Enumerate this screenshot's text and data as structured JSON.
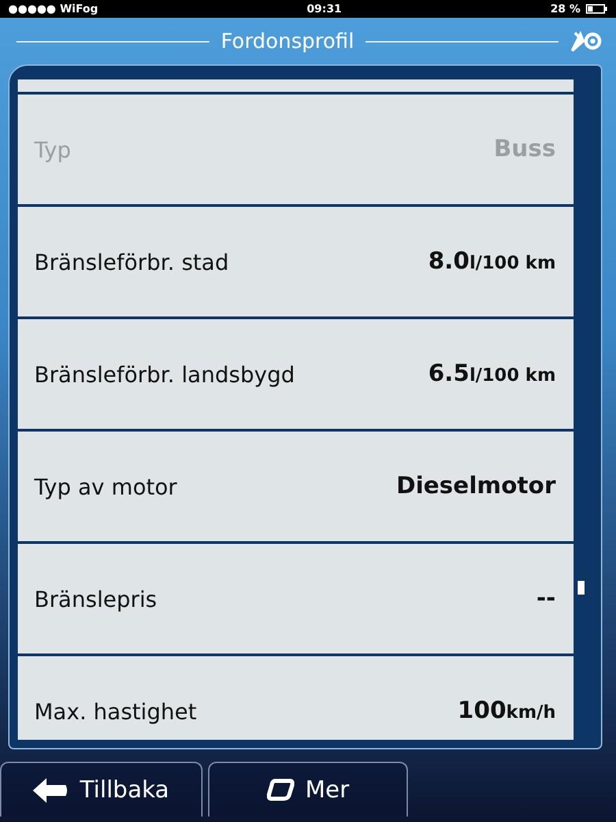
{
  "status_bar": {
    "carrier": "●●●●● WiFog",
    "time": "09:31",
    "battery": "28 %"
  },
  "header": {
    "title": "Fordonsprofil"
  },
  "rows": [
    {
      "label": "Typ",
      "value": "Buss",
      "disabled": true
    },
    {
      "label": "Bränsleförbr. stad",
      "value": "8.0",
      "unit": "l/100 km",
      "disabled": false
    },
    {
      "label": "Bränsleförbr. landsbygd",
      "value": "6.5",
      "unit": "l/100 km",
      "disabled": false
    },
    {
      "label": "Typ av motor",
      "value": "Dieselmotor",
      "disabled": false
    },
    {
      "label": "Bränslepris",
      "value": "--",
      "disabled": false
    },
    {
      "label": "Max. hastighet",
      "value": "100",
      "unit": "km/h",
      "disabled": false
    }
  ],
  "buttons": [
    {
      "kind": "back",
      "label": "Tillbaka"
    },
    {
      "kind": "more",
      "label": "Mer"
    }
  ]
}
